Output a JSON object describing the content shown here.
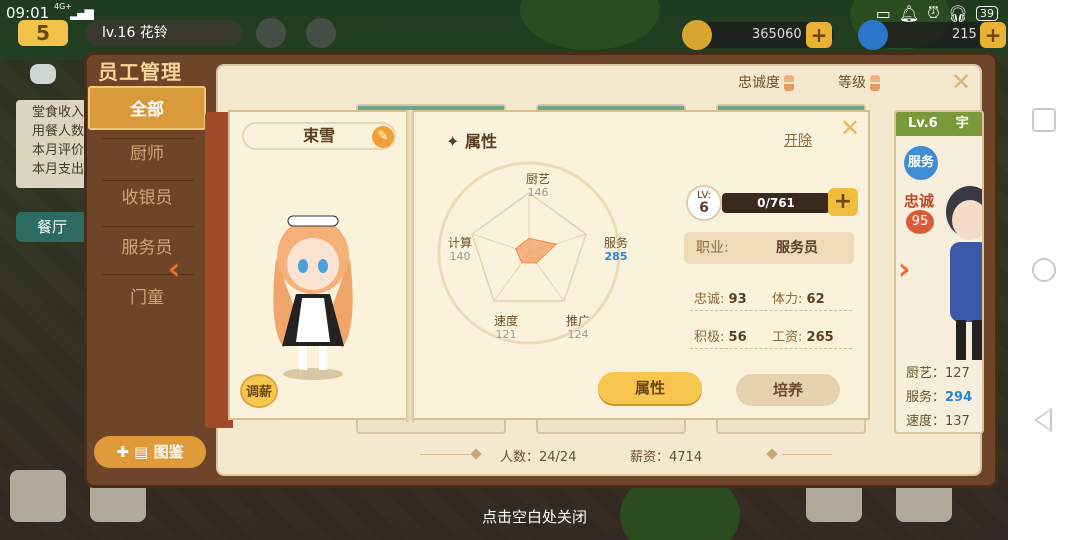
{
  "status_bar": {
    "time": "09:01",
    "network": "4G+",
    "battery": "39"
  },
  "hud": {
    "level_badge": "5",
    "player_name": "lv.16 花铃",
    "coins": "365060",
    "gems": "215",
    "plus": "+"
  },
  "background": {
    "left_info": [
      "堂食收入",
      "用餐人数",
      "本月评价",
      "本月支出"
    ],
    "left_button": "餐厅"
  },
  "panel": {
    "title": "员工管理",
    "tabs": [
      {
        "label": "全部",
        "active": true
      },
      {
        "label": "厨师",
        "active": false
      },
      {
        "label": "收银员",
        "active": false
      },
      {
        "label": "服务员",
        "active": false
      },
      {
        "label": "门童",
        "active": false
      }
    ],
    "atlas_button": "图鉴",
    "sort_loyalty": "忠诚度",
    "sort_level": "等级",
    "close": "✕",
    "headcount": "人数：24/24",
    "salary_total": "薪资：4714"
  },
  "right_card": {
    "level": "Lv.6",
    "name_partial": "宇",
    "role_badge": "服务",
    "loyalty_label": "忠诚",
    "loyalty_value": "95",
    "stats": [
      {
        "label": "厨艺：",
        "value": "127"
      },
      {
        "label": "服务：",
        "value": "294"
      },
      {
        "label": "速度：",
        "value": "137"
      }
    ]
  },
  "detail": {
    "name": "束雪",
    "raise_button": "调薪",
    "attr_heading": "属性",
    "fire_button": "开除",
    "close": "✕",
    "radar": {
      "cooking": {
        "label": "厨艺",
        "value": 146
      },
      "service": {
        "label": "服务",
        "value": 285
      },
      "promotion": {
        "label": "推广",
        "value": 124
      },
      "speed": {
        "label": "速度",
        "value": 121
      },
      "cashier": {
        "label": "计算",
        "value": 140
      }
    },
    "level_label": "LV:",
    "level": "6",
    "xp": "0/761",
    "job_label": "职业:",
    "job": "服务员",
    "loyalty_label": "忠诚:",
    "loyalty": "93",
    "stamina_label": "体力:",
    "stamina": "62",
    "enthusiasm_label": "积极:",
    "enthusiasm": "56",
    "wage_label": "工资:",
    "wage": "265",
    "tab_attr": "属性",
    "tab_train": "培养"
  },
  "hint": "点击空白处关闭",
  "colors": {
    "accent": "#f6c64f",
    "panel_brown": "#6e4528",
    "page": "#fbf2dc",
    "highlight_blue": "#2a86d6"
  }
}
